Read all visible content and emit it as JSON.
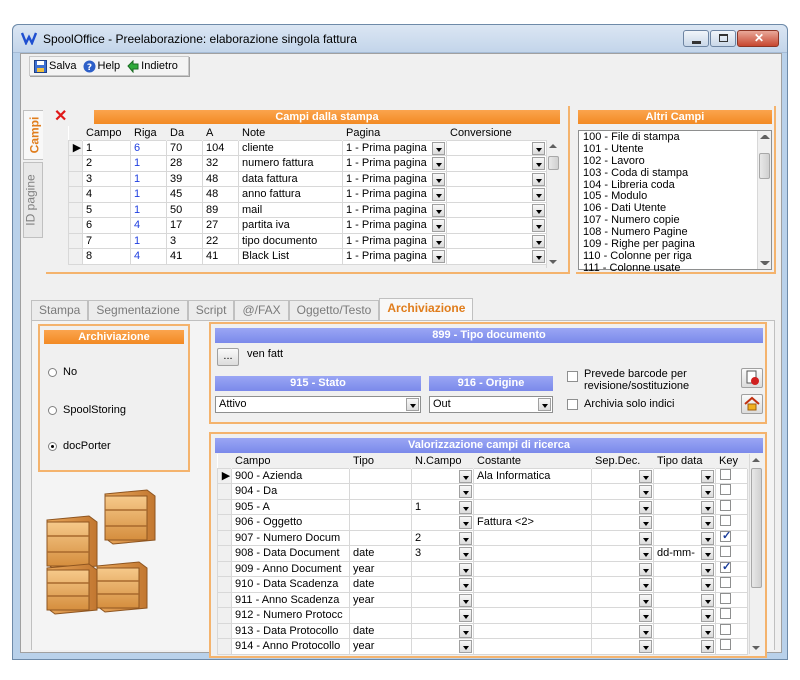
{
  "window": {
    "title": "SpoolOffice - Preelaborazione: elaborazione singola fattura"
  },
  "toolbar": {
    "save": "Salva",
    "help": "Help",
    "back": "Indietro"
  },
  "side_tabs": [
    "Campi",
    "ID pagine"
  ],
  "campi_stampa": {
    "title": "Campi dalla stampa",
    "columns": [
      "Campo",
      "Riga",
      "Da",
      "A",
      "Note",
      "Pagina",
      "Conversione"
    ],
    "rows": [
      {
        "campo": "1",
        "riga": "6",
        "da": "70",
        "a": "104",
        "note": "cliente",
        "pagina": "1 - Prima pagina"
      },
      {
        "campo": "2",
        "riga": "1",
        "da": "28",
        "a": "32",
        "note": "numero fattura",
        "pagina": "1 - Prima pagina"
      },
      {
        "campo": "3",
        "riga": "1",
        "da": "39",
        "a": "48",
        "note": "data fattura",
        "pagina": "1 - Prima pagina"
      },
      {
        "campo": "4",
        "riga": "1",
        "da": "45",
        "a": "48",
        "note": "anno fattura",
        "pagina": "1 - Prima pagina"
      },
      {
        "campo": "5",
        "riga": "1",
        "da": "50",
        "a": "89",
        "note": "mail",
        "pagina": "1 - Prima pagina"
      },
      {
        "campo": "6",
        "riga": "4",
        "da": "17",
        "a": "27",
        "note": "partita iva",
        "pagina": "1 - Prima pagina"
      },
      {
        "campo": "7",
        "riga": "1",
        "da": "3",
        "a": "22",
        "note": "tipo documento",
        "pagina": "1 - Prima pagina"
      },
      {
        "campo": "8",
        "riga": "4",
        "da": "41",
        "a": "41",
        "note": "Black List",
        "pagina": "1 - Prima pagina"
      }
    ]
  },
  "altri_campi": {
    "title": "Altri Campi",
    "items": [
      "100 - File di stampa",
      "101 - Utente",
      "102 - Lavoro",
      "103 - Coda di stampa",
      "104 - Libreria coda",
      "105 - Modulo",
      "106 - Dati Utente",
      "107 - Numero copie",
      "108 - Numero Pagine",
      "109 - Righe per pagina",
      "110 - Colonne per riga",
      "111 - Colonne usate"
    ]
  },
  "tabs": [
    "Stampa",
    "Segmentazione",
    "Script",
    "@/FAX",
    "Oggetto/Testo",
    "Archiviazione"
  ],
  "archiviazione": {
    "title": "Archiviazione",
    "options": [
      "No",
      "SpoolStoring",
      "docPorter"
    ],
    "selected": "docPorter"
  },
  "tipo_documento": {
    "title": "899 - Tipo documento",
    "button": "...",
    "value": "ven fatt"
  },
  "stato": {
    "title": "915 - Stato",
    "value": "Attivo"
  },
  "origine": {
    "title": "916 - Origine",
    "value": "Out"
  },
  "checks": {
    "barcode": "Prevede barcode per revisione/sostituzione",
    "solo_indici": "Archivia solo indici"
  },
  "ricerca": {
    "title": "Valorizzazione campi di ricerca",
    "columns": [
      "Campo",
      "Tipo",
      "N.Campo",
      "Costante",
      "Sep.Dec.",
      "Tipo data",
      "Key"
    ],
    "rows": [
      {
        "campo": "900 - Azienda",
        "tipo": "",
        "ncampo": "",
        "costante": "Ala Informatica",
        "tipodata": "",
        "key": false
      },
      {
        "campo": "904 - Da",
        "tipo": "",
        "ncampo": "",
        "costante": "",
        "tipodata": "",
        "key": false
      },
      {
        "campo": "905 - A",
        "tipo": "",
        "ncampo": "1",
        "costante": "",
        "tipodata": "",
        "key": false
      },
      {
        "campo": "906 - Oggetto",
        "tipo": "",
        "ncampo": "",
        "costante": "Fattura <2>",
        "tipodata": "",
        "key": false
      },
      {
        "campo": "907 - Numero Docum",
        "tipo": "",
        "ncampo": "2",
        "costante": "",
        "tipodata": "",
        "key": true
      },
      {
        "campo": "908 - Data Document",
        "tipo": "date",
        "ncampo": "3",
        "costante": "",
        "tipodata": "dd-mm-",
        "key": false
      },
      {
        "campo": "909 - Anno Document",
        "tipo": "year",
        "ncampo": "",
        "costante": "",
        "tipodata": "",
        "key": true
      },
      {
        "campo": "910 - Data Scadenza",
        "tipo": "date",
        "ncampo": "",
        "costante": "",
        "tipodata": "",
        "key": false
      },
      {
        "campo": "911 - Anno Scadenza",
        "tipo": "year",
        "ncampo": "",
        "costante": "",
        "tipodata": "",
        "key": false
      },
      {
        "campo": "912 - Numero Protocc",
        "tipo": "",
        "ncampo": "",
        "costante": "",
        "tipodata": "",
        "key": false
      },
      {
        "campo": "913 - Data Protocollo",
        "tipo": "date",
        "ncampo": "",
        "costante": "",
        "tipodata": "",
        "key": false
      },
      {
        "campo": "914 - Anno Protocollo",
        "tipo": "year",
        "ncampo": "",
        "costante": "",
        "tipodata": "",
        "key": false
      }
    ]
  }
}
